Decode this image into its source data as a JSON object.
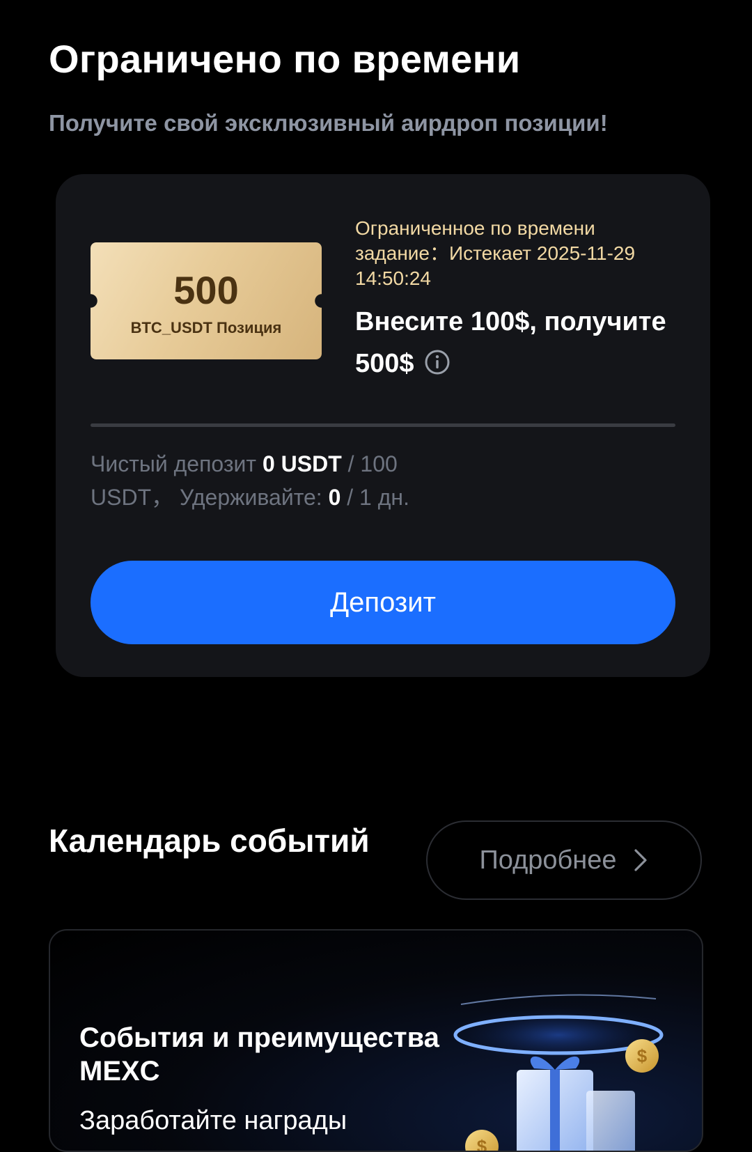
{
  "limited_section": {
    "title": "Ограничено по времени",
    "subtitle": "Получите свой эксклюзивный аирдроп позиции!"
  },
  "task_card": {
    "ticket": {
      "amount": "500",
      "label": "BTC_USDT Позиция"
    },
    "deadline_text": "Ограниченное по времени задание：Истекает 2025-11-29 14:50:24",
    "headline": "Внесите 100$, получите 500$",
    "progress": {
      "fraction": 0,
      "net_deposit_label": "Чистый депозит",
      "net_deposit_value": "0 USDT",
      "net_deposit_target": "/ 100 USDT，",
      "hold_label": "Удерживайте:",
      "hold_value": "0",
      "hold_target": "/ 1 дн."
    },
    "button_label": "Депозит"
  },
  "events_section": {
    "title": "Календарь событий",
    "more_label": "Подробнее"
  },
  "event_card": {
    "title": "События и преимущества MEXC",
    "subtitle": "Заработайте награды"
  },
  "colors": {
    "accent": "#1b6eff",
    "gold_text": "#f2d9a4",
    "card_bg": "#141519"
  },
  "icons": {
    "info": "info-icon",
    "more": "chevron-right-icon"
  }
}
